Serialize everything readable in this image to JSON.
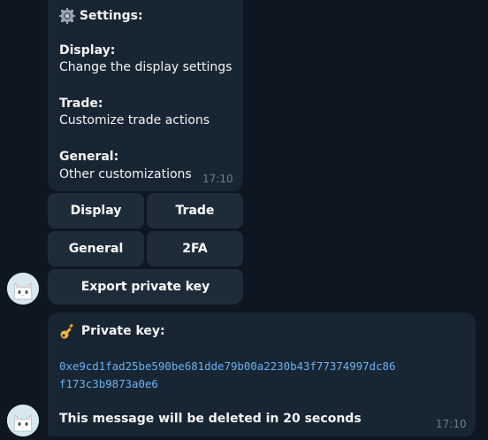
{
  "settings_message": {
    "title": "Settings:",
    "icon": "gear-icon",
    "sections": [
      {
        "heading": "Display:",
        "text": "Change the display settings"
      },
      {
        "heading": "Trade:",
        "text": "Customize trade actions"
      },
      {
        "heading": "General:",
        "text": "Other customizations"
      }
    ],
    "time": "17:10"
  },
  "keyboard": {
    "display": "Display",
    "trade": "Trade",
    "general": "General",
    "twofa": "2FA",
    "export": "Export private key"
  },
  "key_message": {
    "title": "Private key:",
    "icon": "key-icon",
    "key_line1": "0xe9cd1fad25be590be681dde79b00a2230b43f77374997dc86",
    "key_line2": "f173c3b9873a0e6",
    "note": "This message will be deleted in 20 seconds",
    "time": "17:10"
  },
  "colors": {
    "background": "#0e1621",
    "bubble": "#182533",
    "button": "#1e2c3a",
    "link": "#6ab3f3",
    "time": "#6d7f8f"
  }
}
